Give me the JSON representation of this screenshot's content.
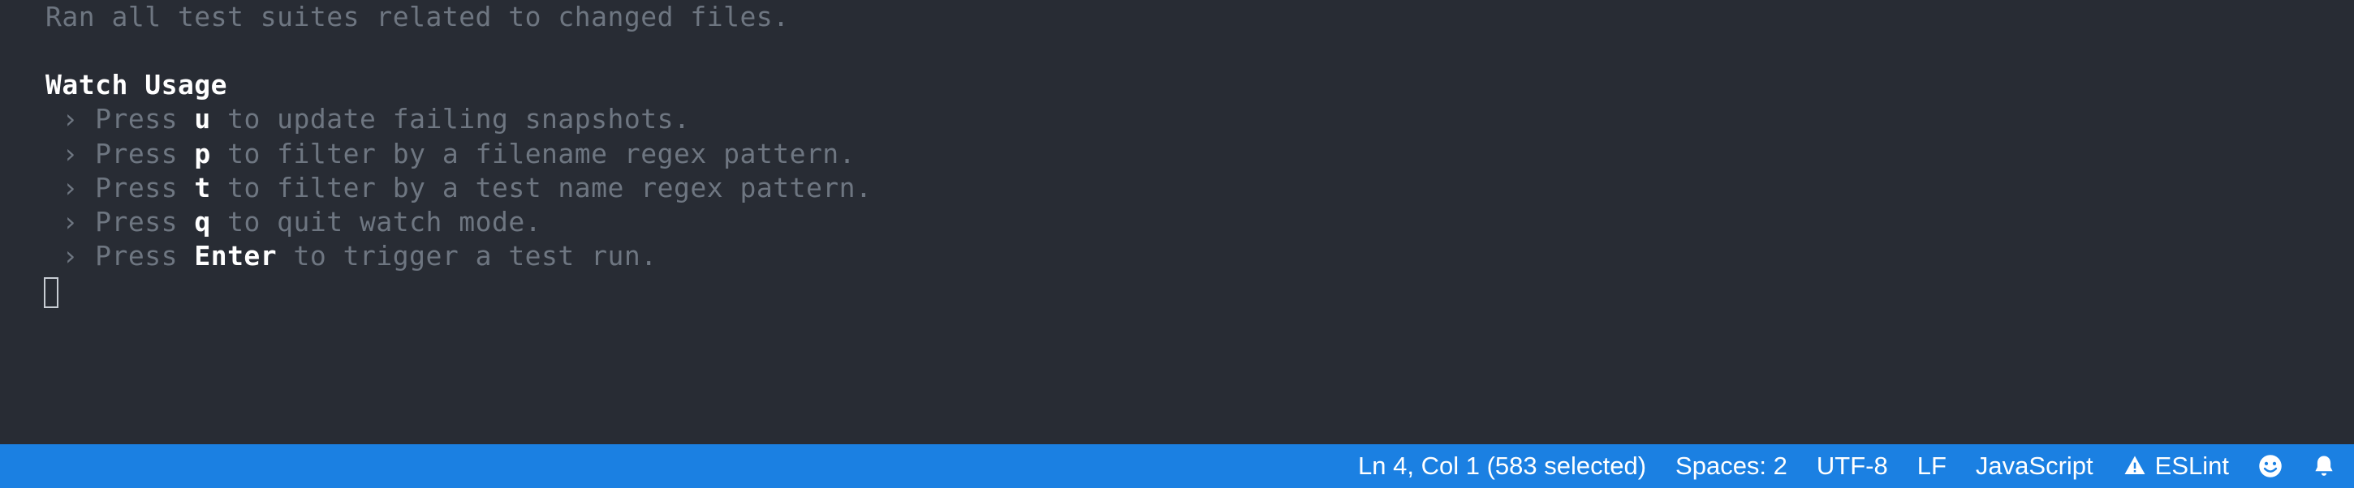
{
  "terminal": {
    "topLine": "Ran all test suites related to changed files.",
    "heading": "Watch Usage",
    "arrow": " › ",
    "press": "Press ",
    "entries": [
      {
        "key": "u",
        "rest": " to update failing snapshots."
      },
      {
        "key": "p",
        "rest": " to filter by a filename regex pattern."
      },
      {
        "key": "t",
        "rest": " to filter by a test name regex pattern."
      },
      {
        "key": "q",
        "rest": " to quit watch mode."
      },
      {
        "key": "Enter",
        "rest": " to trigger a test run."
      }
    ]
  },
  "statusBar": {
    "position": "Ln 4, Col 1 (583 selected)",
    "indent": "Spaces: 2",
    "encoding": "UTF-8",
    "eol": "LF",
    "language": "JavaScript",
    "linter": "ESLint"
  }
}
